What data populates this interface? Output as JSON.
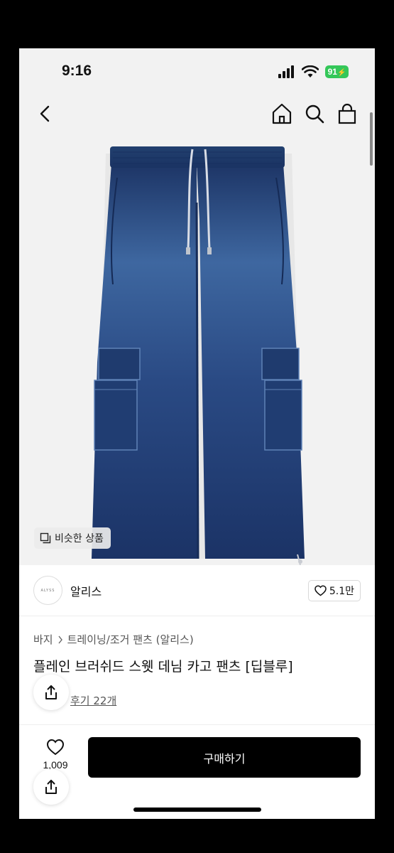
{
  "status_bar": {
    "time": "9:16",
    "battery": "91"
  },
  "product": {
    "similar_label": "비슷한 상품",
    "brand_logo_text": "ALYSS",
    "brand_name": "알리스",
    "like_count": "5.1만",
    "breadcrumb": [
      "바지",
      "트레이닝/조거 팬츠 (알리스)"
    ],
    "title": "플레인 브러쉬드 스웻 데님 카고 팬츠 [딥블루]",
    "reviews": "후기 22개"
  },
  "bottom_bar": {
    "wish_count": "1,009",
    "buy_label": "구매하기"
  },
  "colors": {
    "denim": "#1f3a70",
    "denim_light": "#3f68a2",
    "buy_button": "#000000"
  },
  "icons": [
    "back-icon",
    "home-icon",
    "search-icon",
    "bag-icon",
    "similar-icon",
    "heart-icon",
    "share-icon",
    "chevron-right-icon"
  ]
}
